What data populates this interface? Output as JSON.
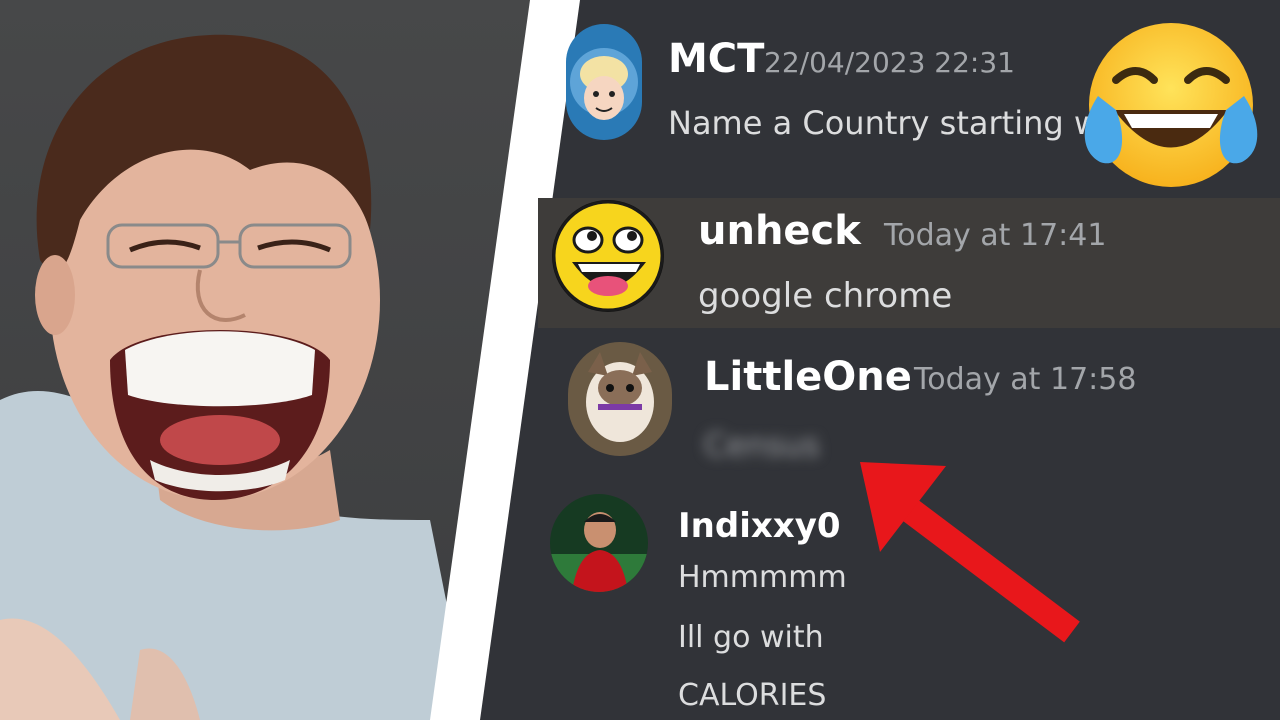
{
  "messages": [
    {
      "username": "MCT",
      "timestamp": "22/04/2023 22:31",
      "lines": [
        "Name a Country starting with"
      ]
    },
    {
      "username": "unheck",
      "timestamp": "Today at 17:41",
      "lines": [
        "google chrome"
      ],
      "highlighted": true
    },
    {
      "username": "LittleOne",
      "timestamp": "Today at 17:58",
      "lines": [
        "Census"
      ],
      "blurred": true
    },
    {
      "username": "Indixxy0",
      "timestamp": "",
      "lines": [
        "Hmmmmm",
        "Ill go with",
        "CALORIES"
      ]
    }
  ],
  "colors": {
    "chat_background": "#313338",
    "highlight": "#3e3c3a",
    "arrow": "#e8171b",
    "username": "#ffffff",
    "timestamp": "#a3a6aa",
    "text": "#dcddde"
  },
  "icons": [
    "face-with-tears-of-joy-icon",
    "red-arrow-icon"
  ]
}
